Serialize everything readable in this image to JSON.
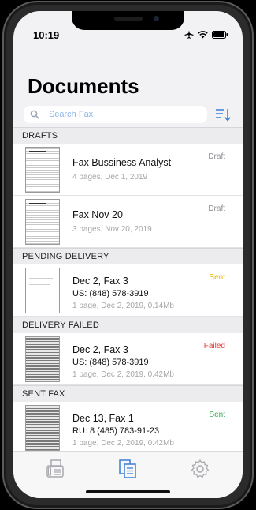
{
  "status_bar": {
    "time": "10:19"
  },
  "header": {
    "title": "Documents"
  },
  "search": {
    "placeholder": "Search Fax"
  },
  "sections": {
    "drafts": {
      "label": "DRAFTS",
      "rows": [
        {
          "title": "Fax Bussiness Analyst",
          "meta": "4 pages, Dec 1, 2019",
          "status": "Draft",
          "status_color": "#8e8e93"
        },
        {
          "title": "Fax Nov 20",
          "meta": "3 pages, Nov 20, 2019",
          "status": "Draft",
          "status_color": "#8e8e93"
        }
      ]
    },
    "pending": {
      "label": "PENDING DELIVERY",
      "rows": [
        {
          "title": "Dec 2, Fax 3",
          "number": "US: (848) 578-3919",
          "meta": "1 page, Dec 2, 2019, 0.14Mb",
          "status": "Sent",
          "status_color": "#e6b800"
        }
      ]
    },
    "failed": {
      "label": "DELIVERY FAILED",
      "rows": [
        {
          "title": "Dec 2, Fax 3",
          "number": "US: (848) 578-3919",
          "meta": "1 page, Dec 2, 2019, 0.42Mb",
          "status": "Failed",
          "status_color": "#e53935"
        }
      ]
    },
    "sent": {
      "label": "SENT FAX",
      "rows": [
        {
          "title": "Dec 13, Fax 1",
          "number": "RU: 8 (485) 783-91-23",
          "meta": "1 page, Dec 2, 2019, 0.42Mb",
          "status": "Sent",
          "status_color": "#34a853"
        }
      ]
    }
  },
  "tab_bar": {
    "tabs": [
      {
        "icon": "fax-machine-icon",
        "active": false
      },
      {
        "icon": "documents-icon",
        "active": true
      },
      {
        "icon": "settings-gear-icon",
        "active": false
      }
    ]
  },
  "colors": {
    "accent": "#3a7fd6",
    "background": "#f2f2f4"
  }
}
